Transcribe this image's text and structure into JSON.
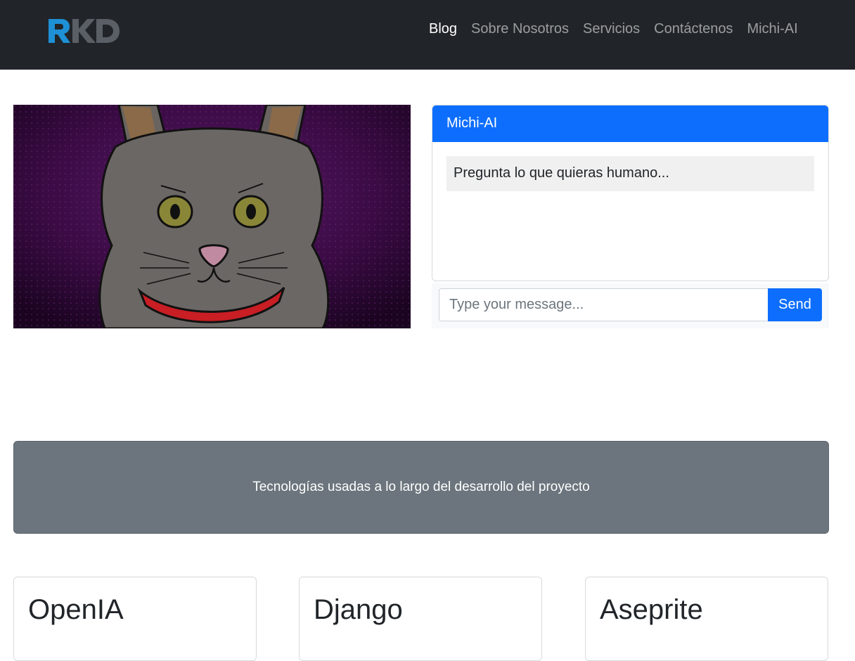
{
  "navbar": {
    "logo_text": "RKD",
    "links": [
      {
        "label": "Blog",
        "active": true
      },
      {
        "label": "Sobre Nosotros",
        "active": false
      },
      {
        "label": "Servicios",
        "active": false
      },
      {
        "label": "Contáctenos",
        "active": false
      },
      {
        "label": "Michi-AI",
        "active": false
      }
    ]
  },
  "hero": {
    "image_icon": "cat-illustration"
  },
  "chat": {
    "header": "Michi-AI",
    "messages": [
      {
        "text": "Pregunta lo que quieras humano..."
      }
    ],
    "input_placeholder": "Type your message...",
    "send_label": "Send"
  },
  "banner": {
    "text": "Tecnologías usadas a lo largo del desarrollo del proyecto"
  },
  "technologies": [
    {
      "name": "OpenIA"
    },
    {
      "name": "Django"
    },
    {
      "name": "Aseprite"
    }
  ],
  "colors": {
    "navbar_bg": "#212529",
    "primary": "#0d6efd",
    "banner_bg": "#6c757d",
    "logo_blue": "#1e90d6",
    "logo_gray": "#5a5f66"
  }
}
